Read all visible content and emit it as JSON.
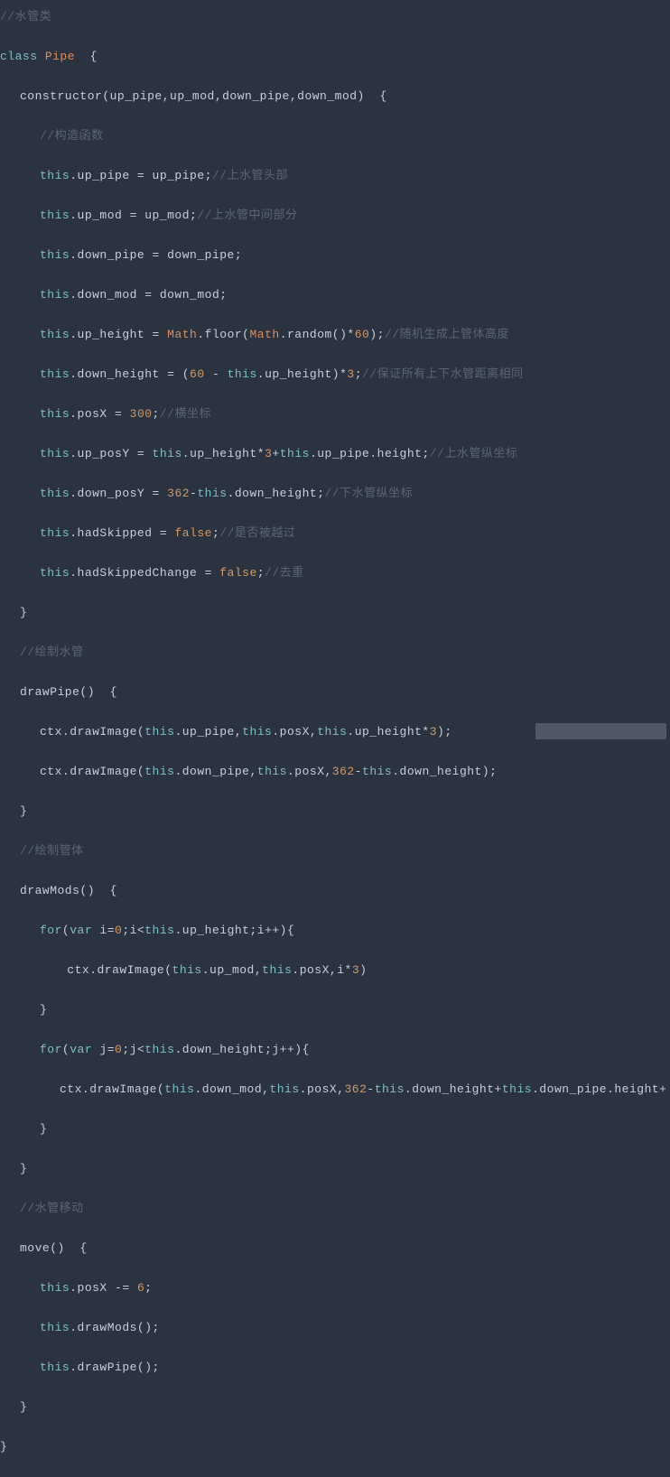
{
  "lines": [
    {
      "indent": 1,
      "segs": [
        {
          "c": "cm",
          "t": "//水管类"
        }
      ]
    },
    {
      "indent": 1,
      "segs": [
        {
          "c": "kw",
          "t": "class "
        },
        {
          "c": "cls",
          "t": "Pipe"
        },
        {
          "c": "pl",
          "t": "  {"
        }
      ]
    },
    {
      "indent": 2,
      "segs": [
        {
          "c": "pl",
          "t": "constructor(up_pipe,up_mod,down_pipe,down_mod)  {"
        }
      ]
    },
    {
      "indent": 3,
      "segs": [
        {
          "c": "cm",
          "t": "//构造函数"
        }
      ]
    },
    {
      "indent": 3,
      "segs": [
        {
          "c": "kw",
          "t": "this"
        },
        {
          "c": "pl",
          "t": ".up_pipe = up_pipe;"
        },
        {
          "c": "cm",
          "t": "//上水管头部"
        }
      ]
    },
    {
      "indent": 3,
      "segs": [
        {
          "c": "kw",
          "t": "this"
        },
        {
          "c": "pl",
          "t": ".up_mod = up_mod;"
        },
        {
          "c": "cm",
          "t": "//上水管中间部分"
        }
      ]
    },
    {
      "indent": 3,
      "segs": [
        {
          "c": "kw",
          "t": "this"
        },
        {
          "c": "pl",
          "t": ".down_pipe = down_pipe;"
        }
      ]
    },
    {
      "indent": 3,
      "segs": [
        {
          "c": "kw",
          "t": "this"
        },
        {
          "c": "pl",
          "t": ".down_mod = down_mod;"
        }
      ]
    },
    {
      "indent": 3,
      "segs": [
        {
          "c": "kw",
          "t": "this"
        },
        {
          "c": "pl",
          "t": ".up_height = "
        },
        {
          "c": "cls",
          "t": "Math"
        },
        {
          "c": "pl",
          "t": ".floor("
        },
        {
          "c": "cls",
          "t": "Math"
        },
        {
          "c": "pl",
          "t": ".random()*"
        },
        {
          "c": "num",
          "t": "60"
        },
        {
          "c": "pl",
          "t": ");"
        },
        {
          "c": "cm",
          "t": "//随机生成上管体高度"
        }
      ]
    },
    {
      "indent": 3,
      "segs": [
        {
          "c": "kw",
          "t": "this"
        },
        {
          "c": "pl",
          "t": ".down_height = ("
        },
        {
          "c": "num",
          "t": "60"
        },
        {
          "c": "pl",
          "t": " - "
        },
        {
          "c": "kw",
          "t": "this"
        },
        {
          "c": "pl",
          "t": ".up_height)*"
        },
        {
          "c": "num",
          "t": "3"
        },
        {
          "c": "pl",
          "t": ";"
        },
        {
          "c": "cm",
          "t": "//保证所有上下水管距离相同"
        }
      ]
    },
    {
      "indent": 3,
      "segs": [
        {
          "c": "kw",
          "t": "this"
        },
        {
          "c": "pl",
          "t": ".posX = "
        },
        {
          "c": "num",
          "t": "300"
        },
        {
          "c": "pl",
          "t": ";"
        },
        {
          "c": "cm",
          "t": "//横坐标"
        }
      ]
    },
    {
      "indent": 3,
      "segs": [
        {
          "c": "kw",
          "t": "this"
        },
        {
          "c": "pl",
          "t": ".up_posY = "
        },
        {
          "c": "kw",
          "t": "this"
        },
        {
          "c": "pl",
          "t": ".up_height*"
        },
        {
          "c": "num",
          "t": "3"
        },
        {
          "c": "pl",
          "t": "+"
        },
        {
          "c": "kw",
          "t": "this"
        },
        {
          "c": "pl",
          "t": ".up_pipe.height;"
        },
        {
          "c": "cm",
          "t": "//上水管纵坐标"
        }
      ]
    },
    {
      "indent": 3,
      "segs": [
        {
          "c": "kw",
          "t": "this"
        },
        {
          "c": "pl",
          "t": ".down_posY = "
        },
        {
          "c": "num",
          "t": "362"
        },
        {
          "c": "pl",
          "t": "-"
        },
        {
          "c": "kw",
          "t": "this"
        },
        {
          "c": "pl",
          "t": ".down_height;"
        },
        {
          "c": "cm",
          "t": "//下水管纵坐标"
        }
      ]
    },
    {
      "indent": 3,
      "segs": [
        {
          "c": "kw",
          "t": "this"
        },
        {
          "c": "pl",
          "t": ".hadSkipped = "
        },
        {
          "c": "bool",
          "t": "false"
        },
        {
          "c": "pl",
          "t": ";"
        },
        {
          "c": "cm",
          "t": "//是否被越过"
        }
      ]
    },
    {
      "indent": 3,
      "segs": [
        {
          "c": "kw",
          "t": "this"
        },
        {
          "c": "pl",
          "t": ".hadSkippedChange = "
        },
        {
          "c": "bool",
          "t": "false"
        },
        {
          "c": "pl",
          "t": ";"
        },
        {
          "c": "cm",
          "t": "//去重"
        }
      ]
    },
    {
      "indent": 2,
      "segs": [
        {
          "c": "pl",
          "t": "}"
        }
      ]
    },
    {
      "indent": 2,
      "segs": [
        {
          "c": "cm",
          "t": "//绘制水管"
        }
      ]
    },
    {
      "indent": 2,
      "segs": [
        {
          "c": "pl",
          "t": "drawPipe()  {"
        }
      ]
    },
    {
      "indent": 3,
      "segs": [
        {
          "c": "pl",
          "t": "ctx.drawImage("
        },
        {
          "c": "kw",
          "t": "this"
        },
        {
          "c": "pl",
          "t": ".up_pipe,"
        },
        {
          "c": "kw",
          "t": "this"
        },
        {
          "c": "pl",
          "t": ".posX,"
        },
        {
          "c": "kw",
          "t": "this"
        },
        {
          "c": "pl",
          "t": ".up_height*"
        },
        {
          "c": "num",
          "t": "3"
        },
        {
          "c": "pl",
          "t": ");"
        }
      ]
    },
    {
      "indent": 3,
      "segs": [
        {
          "c": "pl",
          "t": "ctx.drawImage("
        },
        {
          "c": "kw",
          "t": "this"
        },
        {
          "c": "pl",
          "t": ".down_pipe,"
        },
        {
          "c": "kw",
          "t": "this"
        },
        {
          "c": "pl",
          "t": ".posX,"
        },
        {
          "c": "num",
          "t": "362"
        },
        {
          "c": "pl",
          "t": "-"
        },
        {
          "c": "kw",
          "t": "this"
        },
        {
          "c": "pl",
          "t": ".down_height);"
        }
      ]
    },
    {
      "indent": 2,
      "segs": [
        {
          "c": "pl",
          "t": "}"
        }
      ]
    },
    {
      "indent": 2,
      "segs": [
        {
          "c": "cm",
          "t": "//绘制管体"
        }
      ]
    },
    {
      "indent": 2,
      "segs": [
        {
          "c": "pl",
          "t": "drawMods()  {"
        }
      ]
    },
    {
      "indent": 3,
      "segs": [
        {
          "c": "kw",
          "t": "for"
        },
        {
          "c": "pl",
          "t": "("
        },
        {
          "c": "kw",
          "t": "var"
        },
        {
          "c": "pl",
          "t": " i="
        },
        {
          "c": "num",
          "t": "0"
        },
        {
          "c": "pl",
          "t": ";i<"
        },
        {
          "c": "kw",
          "t": "this"
        },
        {
          "c": "pl",
          "t": ".up_height;i++){"
        }
      ]
    },
    {
      "indent": 4,
      "segs": [
        {
          "c": "pl",
          "t": " ctx.drawImage("
        },
        {
          "c": "kw",
          "t": "this"
        },
        {
          "c": "pl",
          "t": ".up_mod,"
        },
        {
          "c": "kw",
          "t": "this"
        },
        {
          "c": "pl",
          "t": ".posX,i*"
        },
        {
          "c": "num",
          "t": "3"
        },
        {
          "c": "pl",
          "t": ")"
        }
      ]
    },
    {
      "indent": 3,
      "segs": [
        {
          "c": "pl",
          "t": "}"
        }
      ]
    },
    {
      "indent": 3,
      "segs": [
        {
          "c": "kw",
          "t": "for"
        },
        {
          "c": "pl",
          "t": "("
        },
        {
          "c": "kw",
          "t": "var"
        },
        {
          "c": "pl",
          "t": " j="
        },
        {
          "c": "num",
          "t": "0"
        },
        {
          "c": "pl",
          "t": ";j<"
        },
        {
          "c": "kw",
          "t": "this"
        },
        {
          "c": "pl",
          "t": ".down_height;j++){"
        }
      ]
    },
    {
      "indent": 4,
      "segs": [
        {
          "c": "pl",
          "t": "ctx.drawImage("
        },
        {
          "c": "kw",
          "t": "this"
        },
        {
          "c": "pl",
          "t": ".down_mod,"
        },
        {
          "c": "kw",
          "t": "this"
        },
        {
          "c": "pl",
          "t": ".posX,"
        },
        {
          "c": "num",
          "t": "362"
        },
        {
          "c": "pl",
          "t": "-"
        },
        {
          "c": "kw",
          "t": "this"
        },
        {
          "c": "pl",
          "t": ".down_height+"
        },
        {
          "c": "kw",
          "t": "this"
        },
        {
          "c": "pl",
          "t": ".down_pipe.height+"
        }
      ]
    },
    {
      "indent": 3,
      "segs": [
        {
          "c": "pl",
          "t": "}"
        }
      ]
    },
    {
      "indent": 2,
      "segs": [
        {
          "c": "pl",
          "t": "}"
        }
      ]
    },
    {
      "indent": 2,
      "segs": [
        {
          "c": "cm",
          "t": "//水管移动"
        }
      ]
    },
    {
      "indent": 2,
      "segs": [
        {
          "c": "pl",
          "t": "move()  {"
        }
      ]
    },
    {
      "indent": 3,
      "segs": [
        {
          "c": "kw",
          "t": "this"
        },
        {
          "c": "pl",
          "t": ".posX -= "
        },
        {
          "c": "num",
          "t": "6"
        },
        {
          "c": "pl",
          "t": ";"
        }
      ]
    },
    {
      "indent": 3,
      "segs": [
        {
          "c": "kw",
          "t": "this"
        },
        {
          "c": "pl",
          "t": ".drawMods();"
        }
      ]
    },
    {
      "indent": 3,
      "segs": [
        {
          "c": "kw",
          "t": "this"
        },
        {
          "c": "pl",
          "t": ".drawPipe();"
        }
      ]
    },
    {
      "indent": 2,
      "segs": [
        {
          "c": "pl",
          "t": "}"
        }
      ]
    },
    {
      "indent": 1,
      "segs": [
        {
          "c": "pl",
          "t": "}"
        }
      ]
    }
  ]
}
